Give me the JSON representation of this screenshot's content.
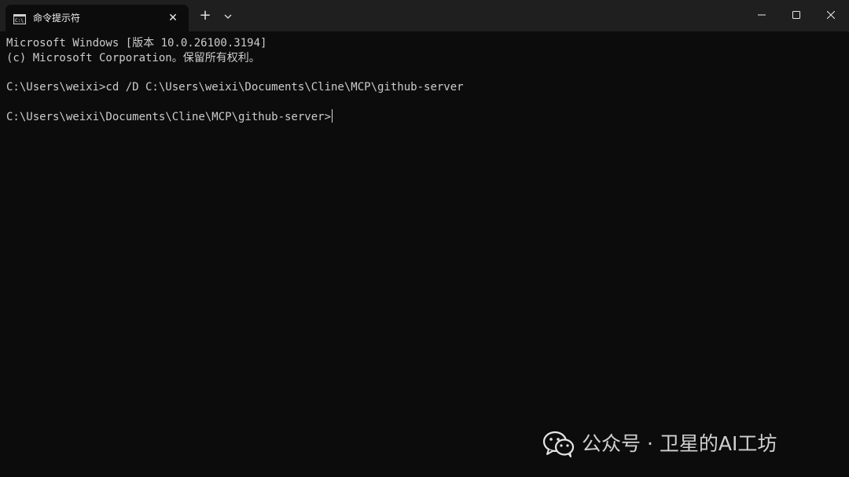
{
  "window": {
    "tab_title": "命令提示符",
    "tab_close_symbol": "✕",
    "new_tab_symbol": "+",
    "icons": {
      "tab": "cmd-terminal-icon",
      "dropdown": "chevron-down-icon",
      "minimize": "minimize-icon",
      "maximize": "maximize-icon",
      "close": "close-icon"
    }
  },
  "terminal": {
    "lines": [
      "Microsoft Windows [版本 10.0.26100.3194]",
      "(c) Microsoft Corporation。保留所有权利。",
      "",
      "C:\\Users\\weixi>cd /D C:\\Users\\weixi\\Documents\\Cline\\MCP\\github-server",
      "",
      "C:\\Users\\weixi\\Documents\\Cline\\MCP\\github-server>"
    ]
  },
  "watermark": {
    "text": "公众号 · 卫星的AI工坊",
    "icon": "wechat-icon"
  },
  "colors": {
    "titlebar_bg": "#1f1f1f",
    "terminal_bg": "#0c0c0c",
    "terminal_text": "#cccccc"
  }
}
